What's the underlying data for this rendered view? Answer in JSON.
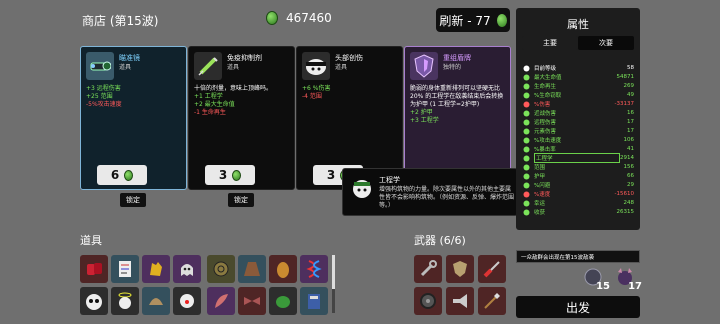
{
  "header": {
    "title": "商店 (第15波)",
    "materials": "467460",
    "refresh_label": "刷新 - 77"
  },
  "shop_cards": [
    {
      "name": "瞄准镜",
      "type": "道具",
      "stats": [
        {
          "text": "+3 远程伤害",
          "color": "green"
        },
        {
          "text": "+25 范围",
          "color": "green"
        },
        {
          "text": "-5%攻击速度",
          "color": "red"
        }
      ],
      "price": "6",
      "lock_label": "锁定",
      "icon": "scope-icon",
      "rarity": "uncommon"
    },
    {
      "name": "免疫抑制剂",
      "type": "道具",
      "stats": [
        {
          "text": "十倍的剂量，意味上顶峰吗。",
          "color": "white"
        },
        {
          "text": "+1 工程学",
          "color": "green"
        },
        {
          "text": "+2 最大生命值",
          "color": "green"
        },
        {
          "text": "-1 生命再生",
          "color": "red"
        }
      ],
      "price": "3",
      "lock_label": "锁定",
      "icon": "syringe-icon",
      "rarity": "common"
    },
    {
      "name": "头部创伤",
      "type": "道具",
      "stats": [
        {
          "text": "+6 %伤害",
          "color": "green"
        },
        {
          "text": "-4 范围",
          "color": "red"
        }
      ],
      "price": "3",
      "lock_label": "锁定",
      "icon": "bandaged-head-icon",
      "rarity": "common"
    },
    {
      "name": "重组盾牌",
      "type": "独特的",
      "stats": [
        {
          "text": "脆弱的身体重新排列可以坚硬无比",
          "color": "white"
        },
        {
          "text": "20% 的工程学在敌袭结束后会转换为护甲 (1 工程学=2护甲)",
          "color": "white"
        },
        {
          "text": "+2 护甲",
          "color": "green"
        },
        {
          "text": "+3 工程学",
          "color": "green"
        }
      ],
      "price": "",
      "lock_label": "",
      "icon": "shield-icon",
      "rarity": "legendary"
    }
  ],
  "tooltip": {
    "title": "工程学",
    "description": "增强构筑物的力量。除次要属性以外的其他主要属性皆不会影响构筑物。（例如资源、反弹、爆炸范围等。）"
  },
  "items_section": {
    "label": "道具",
    "items": [
      "red-gloves-icon",
      "document-icon",
      "golden-hands-icon",
      "ghost-icon",
      "snail-icon",
      "cloak-icon",
      "potato-icon",
      "dna-icon",
      "panda-icon",
      "angel-icon",
      "helmet-icon",
      "clown-icon",
      "feather-icon",
      "bowtie-icon",
      "turtle-icon",
      "book-icon"
    ]
  },
  "weapons_section": {
    "label": "武器 (6/6)",
    "weapons": [
      "wrench-icon",
      "shield-weapon-icon",
      "screwdriver-icon",
      "wheel-icon",
      "megaphone-icon",
      "spear-icon"
    ]
  },
  "stats_panel": {
    "title": "属性",
    "tab_primary": "主要",
    "tab_secondary": "次要",
    "rows": [
      {
        "label": "目前等级",
        "value": "58",
        "icon": "level-icon",
        "color": "#ffffff"
      },
      {
        "label": "最大生命值",
        "value": "54871",
        "icon": "heart-icon",
        "color": "#7be35a"
      },
      {
        "label": "生命再生",
        "value": "269",
        "icon": "regen-icon",
        "color": "#7be35a"
      },
      {
        "label": "%生命窃取",
        "value": "49",
        "icon": "lifesteal-icon",
        "color": "#7be35a"
      },
      {
        "label": "%伤害",
        "value": "-33137",
        "icon": "damage-icon",
        "color": "#ff5a5a"
      },
      {
        "label": "近战伤害",
        "value": "16",
        "icon": "melee-icon",
        "color": "#7be35a"
      },
      {
        "label": "远程伤害",
        "value": "17",
        "icon": "ranged-icon",
        "color": "#7be35a"
      },
      {
        "label": "元素伤害",
        "value": "17",
        "icon": "element-icon",
        "color": "#7be35a"
      },
      {
        "label": "%攻击速度",
        "value": "106",
        "icon": "attack-speed-icon",
        "color": "#7be35a"
      },
      {
        "label": "%暴击率",
        "value": "41",
        "icon": "crit-icon",
        "color": "#7be35a"
      },
      {
        "label": "工程学",
        "value": "2914",
        "icon": "engineering-icon",
        "color": "#7be35a",
        "highlight": true
      },
      {
        "label": "范围",
        "value": "156",
        "icon": "range-icon",
        "color": "#7be35a"
      },
      {
        "label": "护甲",
        "value": "66",
        "icon": "armor-icon",
        "color": "#7be35a"
      },
      {
        "label": "%闪避",
        "value": "29",
        "icon": "dodge-icon",
        "color": "#7be35a"
      },
      {
        "label": "%速度",
        "value": "-15610",
        "icon": "speed-icon",
        "color": "#ff5a5a"
      },
      {
        "label": "幸运",
        "value": "248",
        "icon": "luck-icon",
        "color": "#7be35a"
      },
      {
        "label": "收获",
        "value": "26315",
        "icon": "harvest-icon",
        "color": "#7be35a"
      }
    ]
  },
  "notice": "一众敌群会出现在第15波敌袭",
  "wave_icons": [
    {
      "count": "15",
      "icon": "spiky-enemy-icon"
    },
    {
      "count": "17",
      "icon": "horned-enemy-icon"
    }
  ],
  "go_button": "出发"
}
